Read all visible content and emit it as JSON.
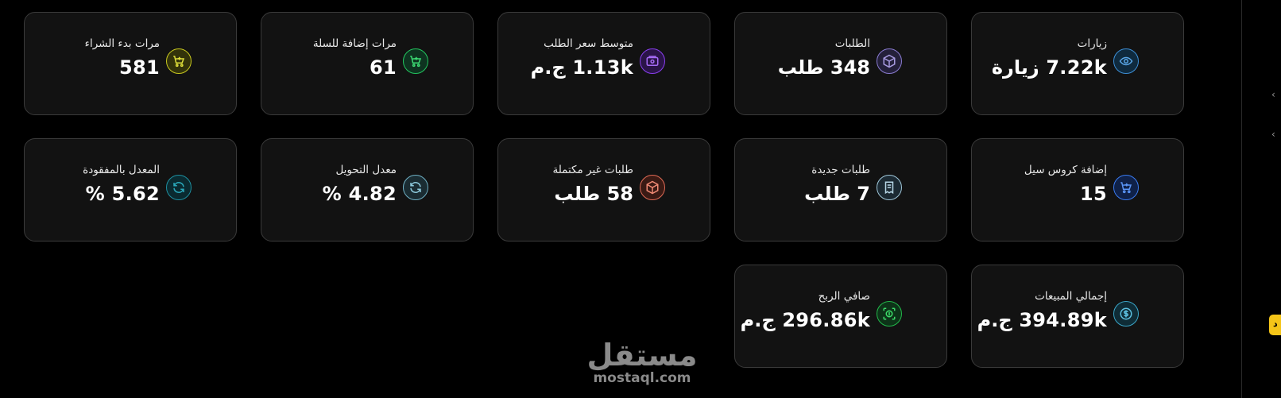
{
  "metrics": {
    "visits": {
      "label": "زيارات",
      "value": "7.22k زيارة",
      "color": "#3d8fd6"
    },
    "orders": {
      "label": "الطلبات",
      "value": "348 طلب",
      "color": "#8a7bd1"
    },
    "avg_order_price": {
      "label": "متوسط سعر الطلب",
      "value": "1.13k ج.م",
      "color": "#8a3ff0"
    },
    "add_to_cart": {
      "label": "مرات إضافة للسلة",
      "value": "61",
      "color": "#22c55e"
    },
    "checkout_starts": {
      "label": "مرات بدء الشراء",
      "value": "581",
      "color": "#c8c81e"
    },
    "cross_sell_add": {
      "label": "إضافة كروس سيل",
      "value": "15",
      "color": "#3b7bf0"
    },
    "new_orders": {
      "label": "طلبات جديدة",
      "value": "7 طلب",
      "color": "#9fc6d9"
    },
    "incomplete_orders": {
      "label": "طلبات غير مكتملة",
      "value": "58 طلب",
      "color": "#e06a55"
    },
    "conversion_rate": {
      "label": "معدل التحويل",
      "value": "4.82 %",
      "color": "#6fb0c4"
    },
    "loss_rate": {
      "label": "المعدل بالمفقودة",
      "value": "5.62 %",
      "color": "#1e8fa0"
    },
    "total_sales": {
      "label": "إجمالي المبيعات",
      "value": "394.89k ج.م",
      "color": "#3aa6c8"
    },
    "net_profit": {
      "label": "صافي الربح",
      "value": "296.86k ج.م",
      "color": "#22b84a"
    }
  },
  "icons": {
    "visits": "eye-icon",
    "orders": "box-icon",
    "avg_order_price": "wallet-icon",
    "add_to_cart": "cart-plus-icon",
    "checkout_starts": "cart-plus-icon",
    "cross_sell_add": "cart-plus-icon",
    "new_orders": "receipt-icon",
    "incomplete_orders": "box-icon",
    "conversion_rate": "refresh-icon",
    "loss_rate": "refresh-icon",
    "total_sales": "dollar-icon",
    "net_profit": "money-icon"
  },
  "edge_tab": {
    "label": "د",
    "color": "#f5c518"
  },
  "watermark": {
    "logo": "مستقل",
    "url": "mostaql.com"
  }
}
